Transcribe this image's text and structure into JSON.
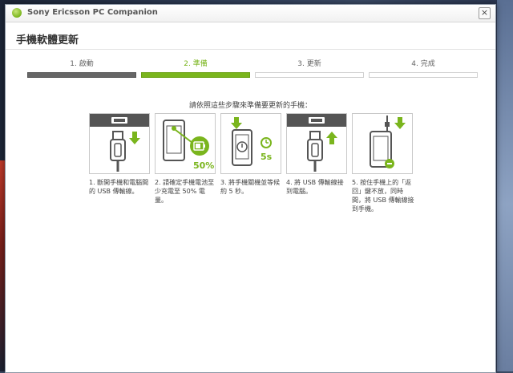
{
  "window": {
    "app_title": "Sony Ericsson PC Companion",
    "close_glyph": "×",
    "page_title": "手機軟體更新"
  },
  "steps": [
    {
      "label": "1. 啟動",
      "state": "done"
    },
    {
      "label": "2. 準備",
      "state": "active"
    },
    {
      "label": "3. 更新",
      "state": "pending"
    },
    {
      "label": "4. 完成",
      "state": "pending"
    }
  ],
  "instruction": "請依照這些步驟來準備要更新的手機：",
  "cards": [
    {
      "icon": "usb-unplug-icon",
      "text": "1. 斷開手機和電腦間的 USB 傳輸線。"
    },
    {
      "icon": "battery-charge-icon",
      "text": "2. 請確定手機電池至少充電至 50% 電量。",
      "badge": "50%"
    },
    {
      "icon": "phone-power-off-icon",
      "text": "3. 將手機關機並等候約 5 秒。",
      "badge": "5s"
    },
    {
      "icon": "usb-plug-icon",
      "text": "4. 將 USB 傳輸線接到電腦。"
    },
    {
      "icon": "phone-connect-icon",
      "text": "5. 按住手機上的「返回」鍵不放，同時間，將 USB 傳輸線接到手機。"
    }
  ],
  "colors": {
    "accent": "#7ab51d",
    "done_bar": "#666666",
    "dark_bar": "#555555"
  }
}
